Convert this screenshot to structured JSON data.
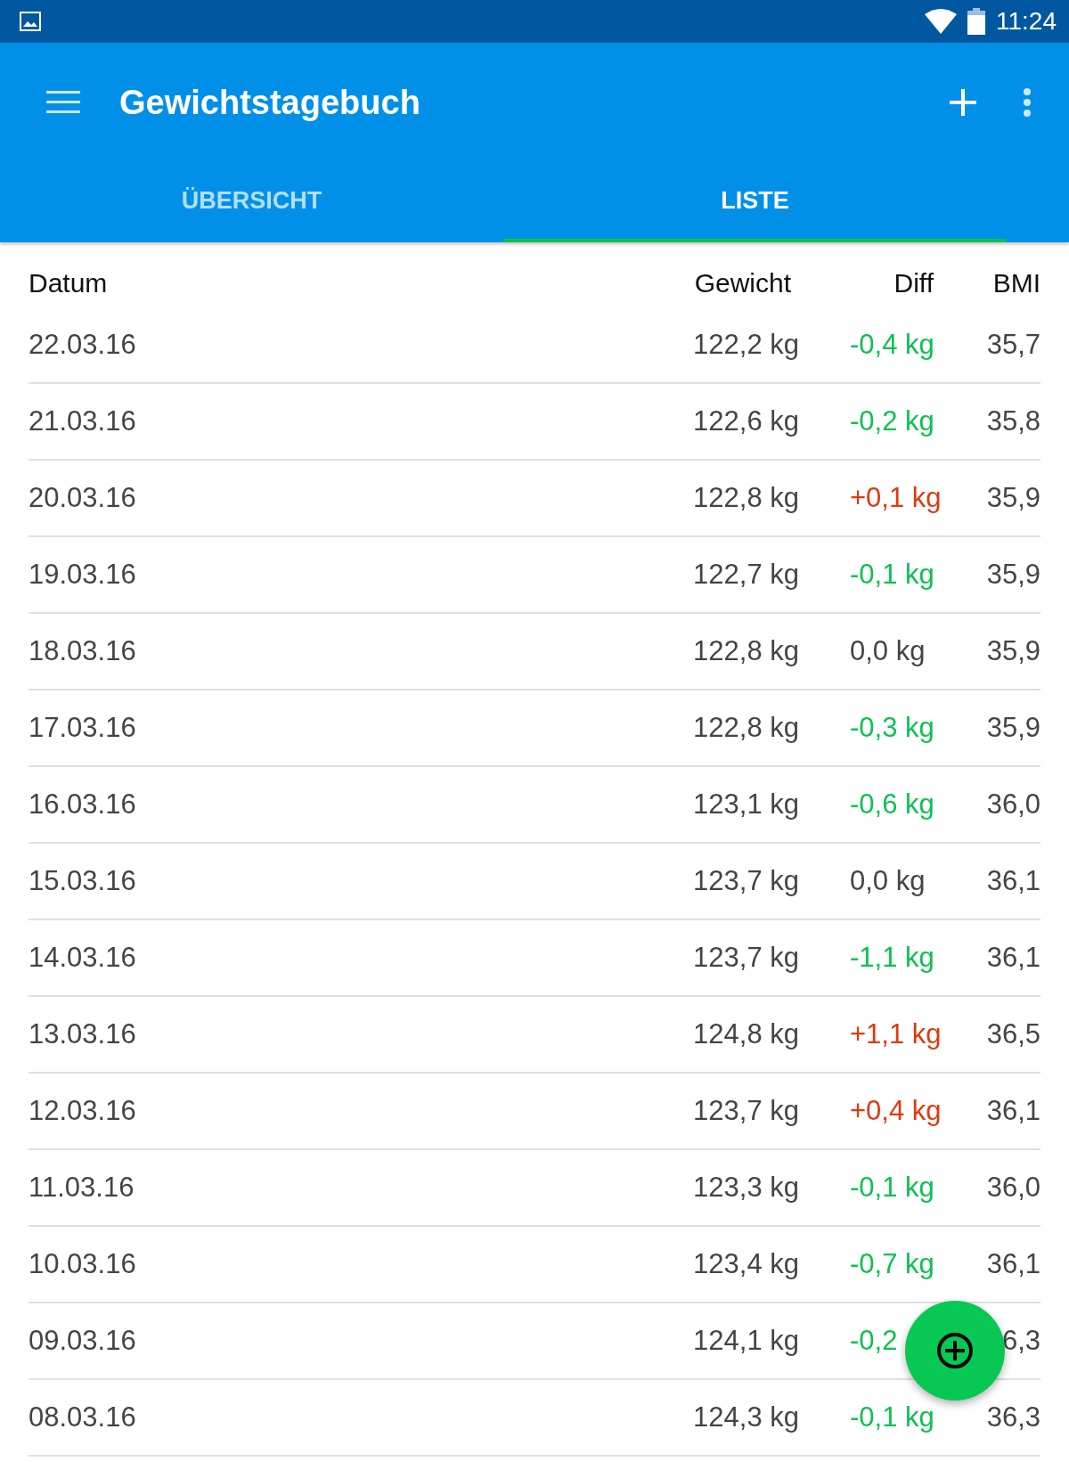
{
  "status_bar": {
    "time": "11:24"
  },
  "app_bar": {
    "title": "Gewichtstagebuch"
  },
  "tabs": [
    {
      "label": "ÜBERSICHT",
      "selected": false
    },
    {
      "label": "LISTE",
      "selected": true
    }
  ],
  "table": {
    "columns": [
      "Datum",
      "Gewicht",
      "Diff",
      "BMI"
    ],
    "rows": [
      {
        "date": "22.03.16",
        "weight": "122,2 kg",
        "diff": "-0,4 kg",
        "color": "#0cc152",
        "bmi": "35,7"
      },
      {
        "date": "21.03.16",
        "weight": "122,6 kg",
        "diff": "-0,2 kg",
        "color": "#0cc152",
        "bmi": "35,8"
      },
      {
        "date": "20.03.16",
        "weight": "122,8 kg",
        "diff": "+0,1 kg",
        "color": "#dd3a10",
        "bmi": "35,9"
      },
      {
        "date": "19.03.16",
        "weight": "122,7 kg",
        "diff": "-0,1 kg",
        "color": "#0cc152",
        "bmi": "35,9"
      },
      {
        "date": "18.03.16",
        "weight": "122,8 kg",
        "diff": "0,0 kg",
        "color": "#444444",
        "bmi": "35,9"
      },
      {
        "date": "17.03.16",
        "weight": "122,8 kg",
        "diff": "-0,3 kg",
        "color": "#0cc152",
        "bmi": "35,9"
      },
      {
        "date": "16.03.16",
        "weight": "123,1 kg",
        "diff": "-0,6 kg",
        "color": "#0cc152",
        "bmi": "36,0"
      },
      {
        "date": "15.03.16",
        "weight": "123,7 kg",
        "diff": "0,0 kg",
        "color": "#444444",
        "bmi": "36,1"
      },
      {
        "date": "14.03.16",
        "weight": "123,7 kg",
        "diff": "-1,1 kg",
        "color": "#0cc152",
        "bmi": "36,1"
      },
      {
        "date": "13.03.16",
        "weight": "124,8 kg",
        "diff": "+1,1 kg",
        "color": "#dd3a10",
        "bmi": "36,5"
      },
      {
        "date": "12.03.16",
        "weight": "123,7 kg",
        "diff": "+0,4 kg",
        "color": "#dd3a10",
        "bmi": "36,1"
      },
      {
        "date": "11.03.16",
        "weight": "123,3 kg",
        "diff": "-0,1 kg",
        "color": "#0cc152",
        "bmi": "36,0"
      },
      {
        "date": "10.03.16",
        "weight": "123,4 kg",
        "diff": "-0,7 kg",
        "color": "#0cc152",
        "bmi": "36,1"
      },
      {
        "date": "09.03.16",
        "weight": "124,1 kg",
        "diff": "-0,2",
        "color": "#0cc152",
        "bmi": "6,3"
      },
      {
        "date": "08.03.16",
        "weight": "124,3 kg",
        "diff": "-0,1 kg",
        "color": "#0cc152",
        "bmi": "36,3"
      }
    ]
  }
}
